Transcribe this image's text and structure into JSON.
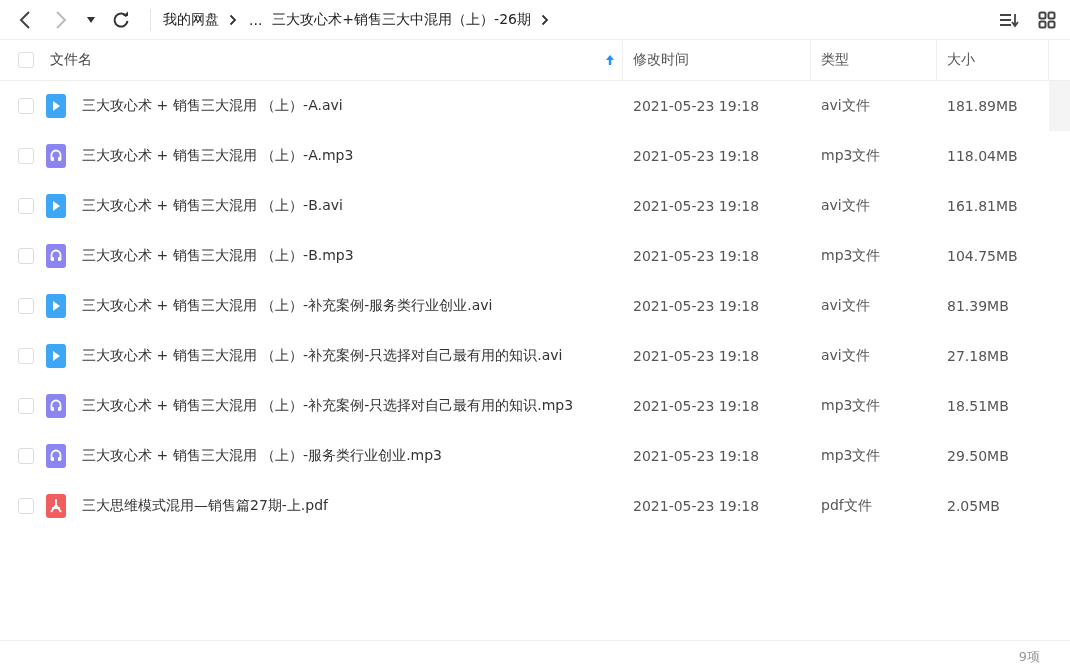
{
  "toolbar": {
    "breadcrumbs": [
      {
        "label": "我的网盘"
      },
      {
        "label": "..."
      },
      {
        "label": "三大攻心术+销售三大中混用（上）-26期"
      }
    ]
  },
  "table": {
    "select_all": {
      "checked": false
    },
    "columns": [
      {
        "label": "文件名",
        "sorted": true
      },
      {
        "label": "修改时间",
        "sorted": false
      },
      {
        "label": "类型",
        "sorted": false
      },
      {
        "label": "大小",
        "sorted": false
      }
    ],
    "rows": [
      {
        "kind": "video",
        "checked": false,
        "name": "三大攻心术 + 销售三大混用 （上）-A.avi",
        "modified": "2021-05-23 19:18",
        "type": "avi文件",
        "size": "181.89MB"
      },
      {
        "kind": "audio",
        "checked": false,
        "name": "三大攻心术 + 销售三大混用 （上）-A.mp3",
        "modified": "2021-05-23 19:18",
        "type": "mp3文件",
        "size": "118.04MB"
      },
      {
        "kind": "video",
        "checked": false,
        "name": "三大攻心术 + 销售三大混用 （上）-B.avi",
        "modified": "2021-05-23 19:18",
        "type": "avi文件",
        "size": "161.81MB"
      },
      {
        "kind": "audio",
        "checked": false,
        "name": "三大攻心术 + 销售三大混用 （上）-B.mp3",
        "modified": "2021-05-23 19:18",
        "type": "mp3文件",
        "size": "104.75MB"
      },
      {
        "kind": "video",
        "checked": false,
        "name": "三大攻心术 + 销售三大混用 （上）-补充案例-服务类行业创业.avi",
        "modified": "2021-05-23 19:18",
        "type": "avi文件",
        "size": "81.39MB"
      },
      {
        "kind": "video",
        "checked": false,
        "name": "三大攻心术 + 销售三大混用 （上）-补充案例-只选择对自己最有用的知识.avi",
        "modified": "2021-05-23 19:18",
        "type": "avi文件",
        "size": "27.18MB"
      },
      {
        "kind": "audio",
        "checked": false,
        "name": "三大攻心术 + 销售三大混用 （上）-补充案例-只选择对自己最有用的知识.mp3",
        "modified": "2021-05-23 19:18",
        "type": "mp3文件",
        "size": "18.51MB"
      },
      {
        "kind": "audio",
        "checked": false,
        "name": "三大攻心术 + 销售三大混用 （上）-服务类行业创业.mp3",
        "modified": "2021-05-23 19:18",
        "type": "mp3文件",
        "size": "29.50MB"
      },
      {
        "kind": "pdf",
        "checked": false,
        "name": "三大思维模式混用—销售篇27期-上.pdf",
        "modified": "2021-05-23 19:18",
        "type": "pdf文件",
        "size": "2.05MB"
      }
    ]
  },
  "status_bar": {
    "count": "9项"
  }
}
